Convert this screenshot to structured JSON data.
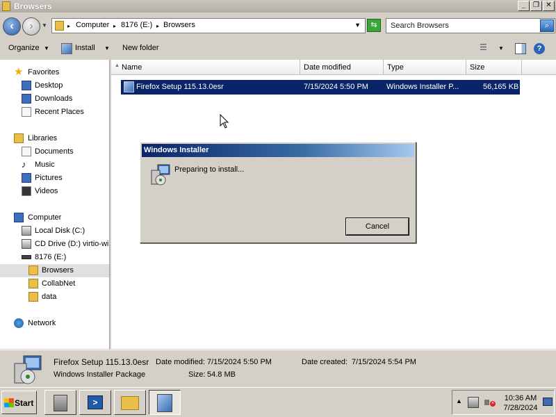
{
  "window": {
    "title": "Browsers"
  },
  "address": {
    "crumbs": [
      "Computer",
      "8176 (E:)",
      "Browsers"
    ],
    "search_placeholder": "Search Browsers"
  },
  "toolbar": {
    "organize": "Organize",
    "install": "Install",
    "new_folder": "New folder"
  },
  "nav": {
    "favorites": "Favorites",
    "desktop": "Desktop",
    "downloads": "Downloads",
    "recent": "Recent Places",
    "libraries": "Libraries",
    "documents": "Documents",
    "music": "Music",
    "pictures": "Pictures",
    "videos": "Videos",
    "computer": "Computer",
    "local_disk": "Local Disk (C:)",
    "cd_drive": "CD Drive (D:) virtio-win",
    "drive_e": "8176 (E:)",
    "browsers": "Browsers",
    "collabnet": "CollabNet",
    "data": "data",
    "network": "Network"
  },
  "columns": {
    "name": "Name",
    "date": "Date modified",
    "type": "Type",
    "size": "Size"
  },
  "file": {
    "name": "Firefox Setup 115.13.0esr",
    "date": "7/15/2024 5:50 PM",
    "type": "Windows Installer P...",
    "size": "56,165 KB"
  },
  "dialog": {
    "title": "Windows Installer",
    "message": "Preparing to install...",
    "cancel": "Cancel"
  },
  "details": {
    "name": "Firefox Setup 115.13.0esr",
    "type": "Windows Installer Package",
    "date_modified_label": "Date modified:",
    "date_modified": "7/15/2024 5:50 PM",
    "date_created_label": "Date created:",
    "date_created": "7/15/2024 5:54 PM",
    "size_label": "Size:",
    "size": "54.8 MB"
  },
  "taskbar": {
    "start": "Start",
    "time": "10:36 AM",
    "date": "7/28/2024"
  }
}
